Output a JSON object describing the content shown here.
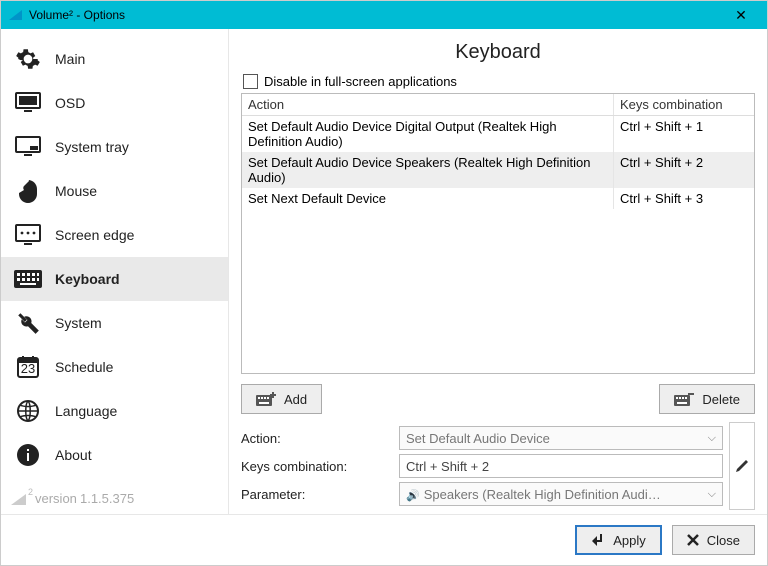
{
  "window": {
    "title": "Volume² - Options"
  },
  "sidebar": {
    "items": [
      {
        "label": "Main"
      },
      {
        "label": "OSD"
      },
      {
        "label": "System tray"
      },
      {
        "label": "Mouse"
      },
      {
        "label": "Screen edge"
      },
      {
        "label": "Keyboard"
      },
      {
        "label": "System"
      },
      {
        "label": "Schedule"
      },
      {
        "label": "Language"
      },
      {
        "label": "About"
      }
    ],
    "version_prefix": "version",
    "version": "1.1.5.375",
    "logo_superscript": "2"
  },
  "page": {
    "title": "Keyboard",
    "disable_checkbox_label": "Disable in full-screen applications",
    "columns": {
      "action": "Action",
      "keys": "Keys combination"
    },
    "rows": [
      {
        "action": "Set Default Audio Device Digital Output (Realtek High Definition Audio)",
        "keys": "Ctrl + Shift + 1"
      },
      {
        "action": "Set Default Audio Device Speakers (Realtek High Definition Audio)",
        "keys": "Ctrl + Shift + 2"
      },
      {
        "action": "Set Next Default Device",
        "keys": "Ctrl + Shift + 3"
      }
    ],
    "buttons": {
      "add": "Add",
      "delete": "Delete"
    },
    "form": {
      "action_label": "Action:",
      "action_value": "Set Default Audio Device",
      "keys_label": "Keys combination:",
      "keys_value": "Ctrl + Shift + 2",
      "param_label": "Parameter:",
      "param_value": "Speakers (Realtek High Definition Audi…"
    }
  },
  "footer": {
    "apply": "Apply",
    "close": "Close"
  }
}
